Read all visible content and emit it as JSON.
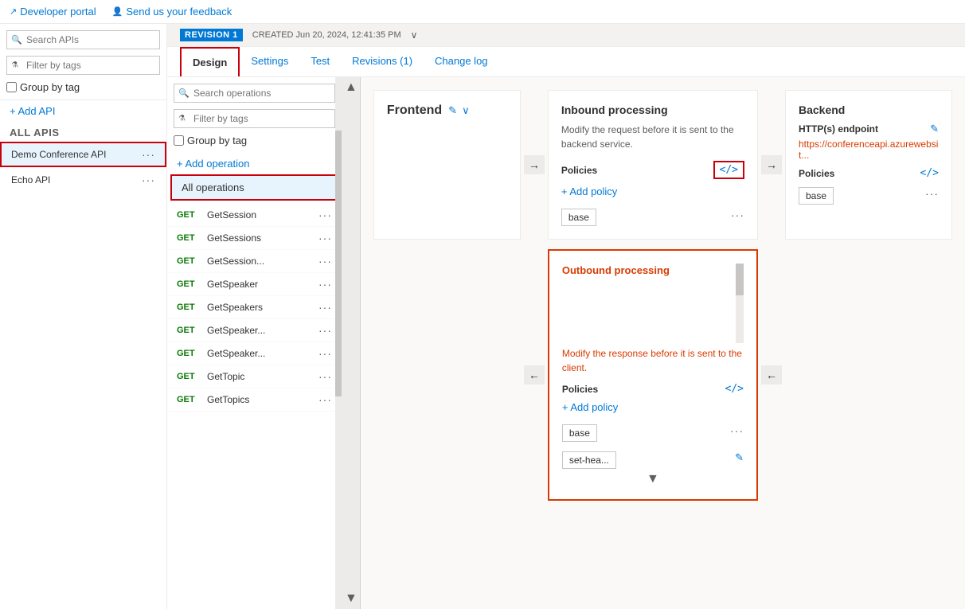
{
  "topbar": {
    "developer_portal_label": "Developer portal",
    "feedback_label": "Send us your feedback"
  },
  "revision_bar": {
    "badge": "REVISION 1",
    "created_label": "CREATED Jun 20, 2024, 12:41:35 PM"
  },
  "tabs": [
    {
      "id": "design",
      "label": "Design",
      "active": true
    },
    {
      "id": "settings",
      "label": "Settings",
      "active": false
    },
    {
      "id": "test",
      "label": "Test",
      "active": false
    },
    {
      "id": "revisions",
      "label": "Revisions (1)",
      "active": false
    },
    {
      "id": "changelog",
      "label": "Change log",
      "active": false
    }
  ],
  "sidebar": {
    "search_placeholder": "Search APIs",
    "filter_placeholder": "Filter by tags",
    "group_by_tag_label": "Group by tag",
    "add_api_label": "+ Add API",
    "all_apis_label": "All APIs",
    "apis": [
      {
        "id": "demo",
        "name": "Demo Conference API",
        "selected": true
      },
      {
        "id": "echo",
        "name": "Echo API",
        "selected": false
      }
    ]
  },
  "operations": {
    "search_placeholder": "Search operations",
    "filter_placeholder": "Filter by tags",
    "group_by_tag_label": "Group by tag",
    "add_operation_label": "+ Add operation",
    "all_operations_label": "All operations",
    "items": [
      {
        "method": "GET",
        "name": "GetSession"
      },
      {
        "method": "GET",
        "name": "GetSessions"
      },
      {
        "method": "GET",
        "name": "GetSession..."
      },
      {
        "method": "GET",
        "name": "GetSpeaker"
      },
      {
        "method": "GET",
        "name": "GetSpeakers"
      },
      {
        "method": "GET",
        "name": "GetSpeaker..."
      },
      {
        "method": "GET",
        "name": "GetSpeaker..."
      },
      {
        "method": "GET",
        "name": "GetTopic"
      },
      {
        "method": "GET",
        "name": "GetTopics"
      }
    ]
  },
  "frontend": {
    "title": "Frontend"
  },
  "inbound": {
    "title": "Inbound processing",
    "description": "Modify the request before it is sent to the backend service.",
    "policies_label": "Policies",
    "add_policy_label": "+ Add policy",
    "base_tag": "base"
  },
  "backend": {
    "title": "Backend",
    "endpoint_label": "HTTP(s) endpoint",
    "endpoint_url": "https://conferenceapi.azurewebsit...",
    "policies_label": "Policies",
    "base_tag": "base"
  },
  "outbound": {
    "title": "Outbound processing",
    "description": "Modify the response before it is sent to the client.",
    "policies_label": "Policies",
    "add_policy_label": "+ Add policy",
    "base_tag": "base",
    "set_hea_tag": "set-hea..."
  },
  "icons": {
    "search": "🔍",
    "filter": "⚗",
    "code": "</>",
    "edit": "✎",
    "chevron_down": "∨",
    "plus": "+",
    "arrow_right": "→",
    "arrow_left": "←",
    "ellipsis": "···",
    "external_link": "↗"
  }
}
